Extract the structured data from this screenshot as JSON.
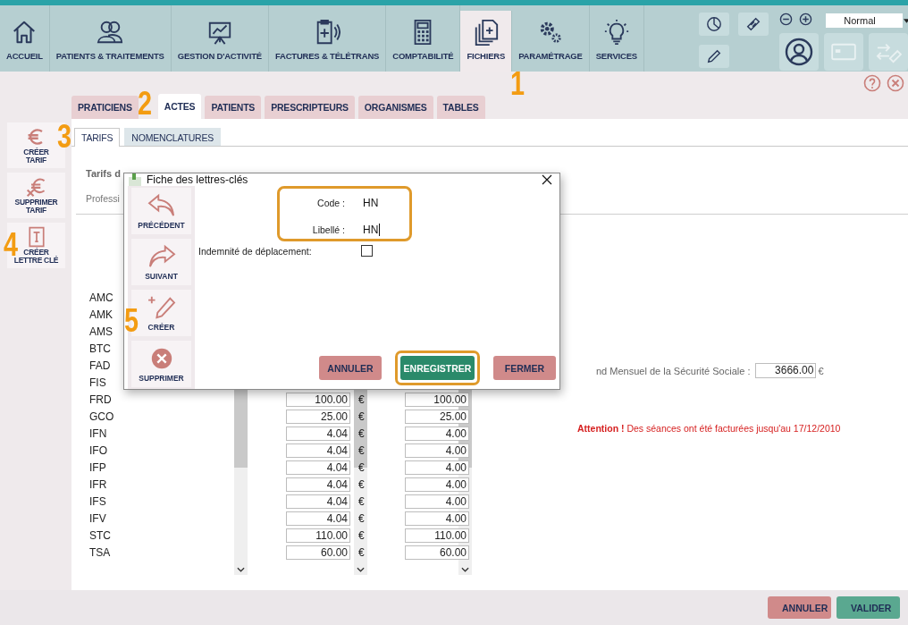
{
  "nav": {
    "items": [
      {
        "label": "ACCUEIL",
        "selected": false
      },
      {
        "label": "PATIENTS & TRAITEMENTS",
        "selected": false
      },
      {
        "label": "GESTION D'ACTIVITÉ",
        "selected": false
      },
      {
        "label": "FACTURES & TÉLÉTRANS",
        "selected": false
      },
      {
        "label": "COMPTABILITÉ",
        "selected": false
      },
      {
        "label": "FICHIERS",
        "selected": true
      },
      {
        "label": "PARAMÉTRAGE",
        "selected": false
      },
      {
        "label": "SERVICES",
        "selected": false
      }
    ],
    "display_select": {
      "value": "Normal"
    }
  },
  "tabs": [
    {
      "label": "PRATICIENS",
      "selected": false
    },
    {
      "label": "ACTES",
      "selected": true
    },
    {
      "label": "PATIENTS",
      "selected": false
    },
    {
      "label": "PRESCRIPTEURS",
      "selected": false
    },
    {
      "label": "ORGANISMES",
      "selected": false
    },
    {
      "label": "TABLES",
      "selected": false
    }
  ],
  "sidebar_buttons": [
    {
      "lines": [
        "CRÉER",
        "TARIF"
      ]
    },
    {
      "lines": [
        "SUPPRIMER",
        "TARIF"
      ]
    },
    {
      "lines": [
        "CRÉER",
        "LETTRE CLÉ"
      ]
    }
  ],
  "subtabs": [
    {
      "label": "TARIFS",
      "selected": true
    },
    {
      "label": "NOMENCLATURES",
      "selected": false
    }
  ],
  "content": {
    "heading": "Tarifs d",
    "subheading": "Professi",
    "rows": [
      {
        "code": "AMC"
      },
      {
        "code": "AMK"
      },
      {
        "code": "AMS"
      },
      {
        "code": "BTC"
      },
      {
        "code": "FAD"
      },
      {
        "code": "FIS"
      },
      {
        "code": "FRD",
        "value_1": "100.00",
        "currency": "€",
        "value_2": "100.00"
      },
      {
        "code": "GCO",
        "value_1": "25.00",
        "currency": "€",
        "value_2": "25.00"
      },
      {
        "code": "IFN",
        "value_1": "4.04",
        "currency": "€",
        "value_2": "4.00"
      },
      {
        "code": "IFO",
        "value_1": "4.04",
        "currency": "€",
        "value_2": "4.00"
      },
      {
        "code": "IFP",
        "value_1": "4.04",
        "currency": "€",
        "value_2": "4.00"
      },
      {
        "code": "IFR",
        "value_1": "4.04",
        "currency": "€",
        "value_2": "4.00"
      },
      {
        "code": "IFS",
        "value_1": "4.04",
        "currency": "€",
        "value_2": "4.00"
      },
      {
        "code": "IFV",
        "value_1": "4.04",
        "currency": "€",
        "value_2": "4.00"
      },
      {
        "code": "STC",
        "value_1": "110.00",
        "currency": "€",
        "value_2": "110.00"
      },
      {
        "code": "TSA",
        "value_1": "60.00",
        "currency": "€",
        "value_2": "60.00"
      }
    ],
    "ceiling_label": "nd Mensuel de la Sécurité Sociale :",
    "ceiling_value": "3666.00",
    "ceiling_currency": "€",
    "warning": "**Attention !** Des séances ont été facturées jusqu'au 17/12/2010"
  },
  "dialog": {
    "title": "Fiche des lettres-clés",
    "tools": [
      {
        "label": "PRÉCÉDENT"
      },
      {
        "label": "SUIVANT"
      },
      {
        "label": "CRÉER"
      },
      {
        "label": "SUPPRIMER"
      }
    ],
    "code_label": "Code :",
    "code_value": "HN",
    "name_label": "Libellé :",
    "name_value": "HN",
    "fields_highlighted": true,
    "travel_label": "Indemnité de déplacement:",
    "travel_checked": false,
    "buttons": [
      {
        "label": "ANNULER",
        "kind": "cancel",
        "highlighted": false
      },
      {
        "label": "ENREGISTRER",
        "kind": "confirm",
        "highlighted": true
      },
      {
        "label": "FERMER",
        "kind": "cancel",
        "highlighted": false
      }
    ]
  },
  "footer_buttons": [
    {
      "label": "ANNULER",
      "kind": "cancel"
    },
    {
      "label": "VALIDER",
      "kind": "confirm"
    }
  ],
  "callouts": [
    "1",
    "2",
    "3",
    "4",
    "5"
  ]
}
